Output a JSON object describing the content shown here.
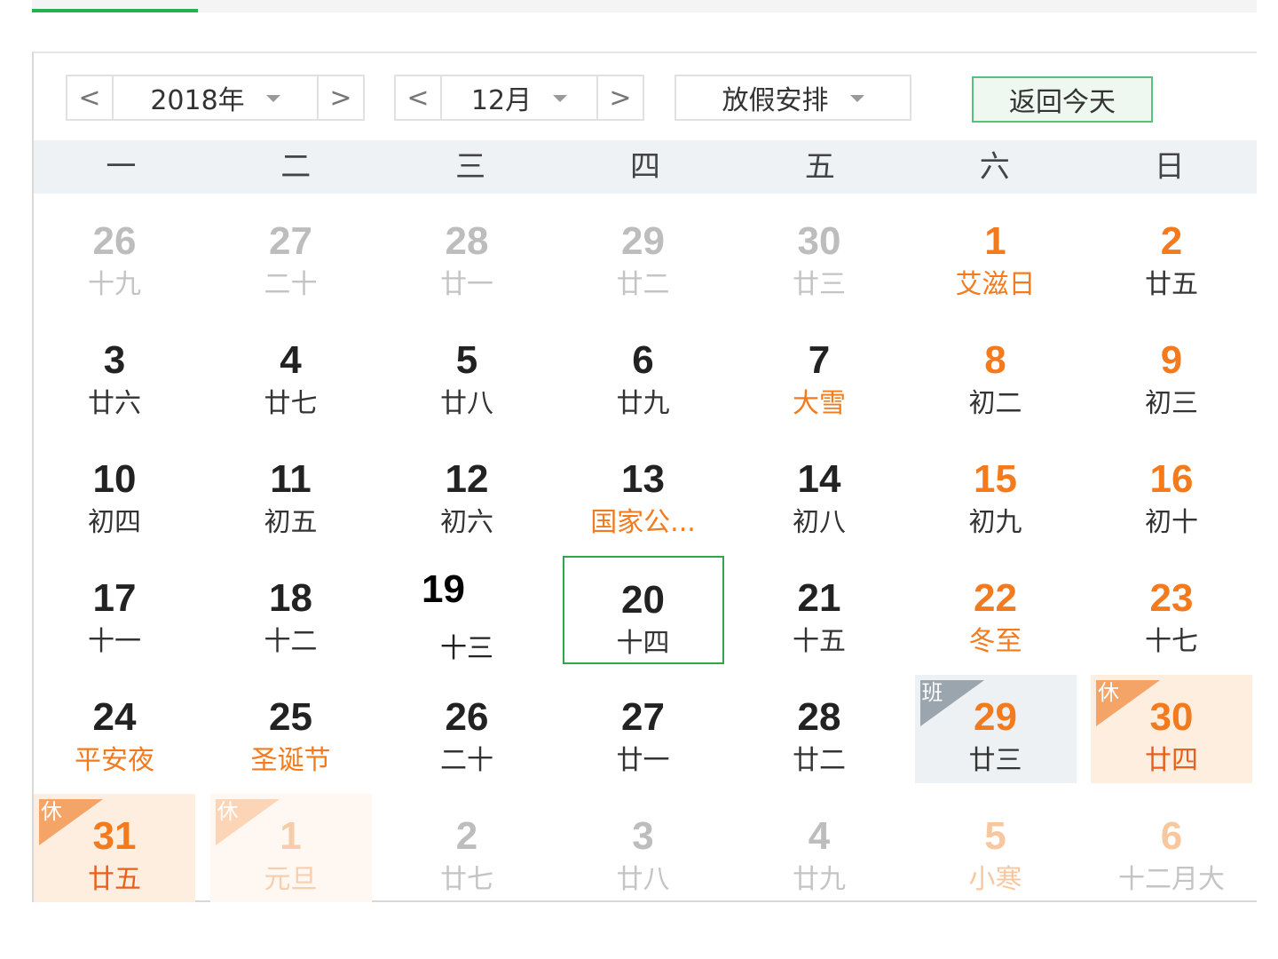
{
  "controls": {
    "year": "2018年",
    "month": "12月",
    "holiday": "放假安排",
    "today_button": "返回今天",
    "prev": "<",
    "next": ">"
  },
  "weekdays": [
    "一",
    "二",
    "三",
    "四",
    "五",
    "六",
    "日"
  ],
  "days": [
    {
      "num": "26",
      "lunar": "十九",
      "type": "other"
    },
    {
      "num": "27",
      "lunar": "二十",
      "type": "other"
    },
    {
      "num": "28",
      "lunar": "廿一",
      "type": "other"
    },
    {
      "num": "29",
      "lunar": "廿二",
      "type": "other"
    },
    {
      "num": "30",
      "lunar": "廿三",
      "type": "other"
    },
    {
      "num": "1",
      "lunar": "艾滋日",
      "type": "weekend",
      "festival": true
    },
    {
      "num": "2",
      "lunar": "廿五",
      "type": "weekend"
    },
    {
      "num": "3",
      "lunar": "廿六",
      "type": "normal"
    },
    {
      "num": "4",
      "lunar": "廿七",
      "type": "normal"
    },
    {
      "num": "5",
      "lunar": "廿八",
      "type": "normal"
    },
    {
      "num": "6",
      "lunar": "廿九",
      "type": "normal"
    },
    {
      "num": "7",
      "lunar": "大雪",
      "type": "normal",
      "festival": true
    },
    {
      "num": "8",
      "lunar": "初二",
      "type": "weekend"
    },
    {
      "num": "9",
      "lunar": "初三",
      "type": "weekend"
    },
    {
      "num": "10",
      "lunar": "初四",
      "type": "normal"
    },
    {
      "num": "11",
      "lunar": "初五",
      "type": "normal"
    },
    {
      "num": "12",
      "lunar": "初六",
      "type": "normal"
    },
    {
      "num": "13",
      "lunar": "国家公...",
      "type": "normal",
      "festival": true
    },
    {
      "num": "14",
      "lunar": "初八",
      "type": "normal"
    },
    {
      "num": "15",
      "lunar": "初九",
      "type": "weekend"
    },
    {
      "num": "16",
      "lunar": "初十",
      "type": "weekend"
    },
    {
      "num": "17",
      "lunar": "十一",
      "type": "normal"
    },
    {
      "num": "18",
      "lunar": "十二",
      "type": "normal"
    },
    {
      "num": "19",
      "lunar": "十三",
      "type": "plain"
    },
    {
      "num": "20",
      "lunar": "十四",
      "type": "today"
    },
    {
      "num": "21",
      "lunar": "十五",
      "type": "normal"
    },
    {
      "num": "22",
      "lunar": "冬至",
      "type": "weekend",
      "festival": true
    },
    {
      "num": "23",
      "lunar": "十七",
      "type": "weekend"
    },
    {
      "num": "24",
      "lunar": "平安夜",
      "type": "normal",
      "festival": true
    },
    {
      "num": "25",
      "lunar": "圣诞节",
      "type": "normal",
      "festival": true
    },
    {
      "num": "26",
      "lunar": "二十",
      "type": "normal"
    },
    {
      "num": "27",
      "lunar": "廿一",
      "type": "normal"
    },
    {
      "num": "28",
      "lunar": "廿二",
      "type": "normal"
    },
    {
      "num": "29",
      "lunar": "廿三",
      "type": "work",
      "badge": "班"
    },
    {
      "num": "30",
      "lunar": "廿四",
      "type": "rest",
      "badge": "休"
    },
    {
      "num": "31",
      "lunar": "廿五",
      "type": "rest",
      "badge": "休"
    },
    {
      "num": "1",
      "lunar": "元旦",
      "type": "rest-light",
      "badge": "休"
    },
    {
      "num": "2",
      "lunar": "廿七",
      "type": "other"
    },
    {
      "num": "3",
      "lunar": "廿八",
      "type": "other"
    },
    {
      "num": "4",
      "lunar": "廿九",
      "type": "other"
    },
    {
      "num": "5",
      "lunar": "小寒",
      "type": "other-weekend"
    },
    {
      "num": "6",
      "lunar": "十二月大",
      "type": "other-weekend-gray"
    }
  ]
}
